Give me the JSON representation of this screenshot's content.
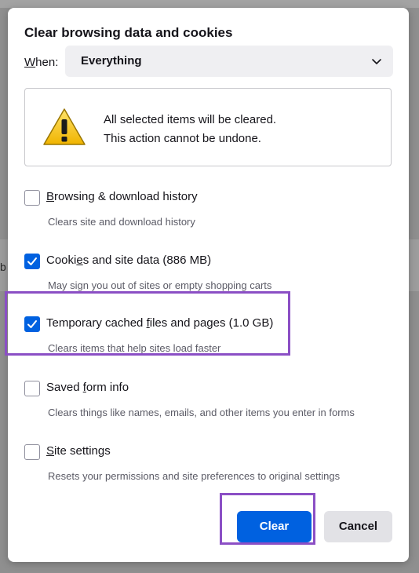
{
  "dialog": {
    "title": "Clear browsing data and cookies",
    "when_label_prefix": "W",
    "when_label_rest": "hen:",
    "when_value": "Everything",
    "warning_line1": "All selected items will be cleared.",
    "warning_line2": "This action cannot be undone."
  },
  "options": [
    {
      "pre": "",
      "u": "B",
      "post": "rowsing & download history",
      "desc": "Clears site and download history",
      "checked": false
    },
    {
      "pre": "Cooki",
      "u": "e",
      "post": "s and site data (886 MB)",
      "desc": "May sign you out of sites or empty shopping carts",
      "checked": true
    },
    {
      "pre": "Temporary cached ",
      "u": "f",
      "post": "iles and pages (1.0 GB)",
      "desc": "Clears items that help sites load faster",
      "checked": true
    },
    {
      "pre": "Saved ",
      "u": "f",
      "post": "orm info",
      "desc": "Clears things like names, emails, and other items you enter in forms",
      "checked": false
    },
    {
      "pre": "",
      "u": "S",
      "post": "ite settings",
      "desc": "Resets your permissions and site preferences to original settings",
      "checked": false
    }
  ],
  "buttons": {
    "clear": "Clear",
    "cancel": "Cancel"
  },
  "backdrop": {
    "peek_text": "b"
  },
  "colors": {
    "accent": "#0061e0",
    "highlight": "#8b4fc5",
    "warning": "#f5c400"
  },
  "icons": {
    "warning": "warning-icon",
    "chevron": "chevron-down-icon",
    "check": "checkmark-icon"
  }
}
